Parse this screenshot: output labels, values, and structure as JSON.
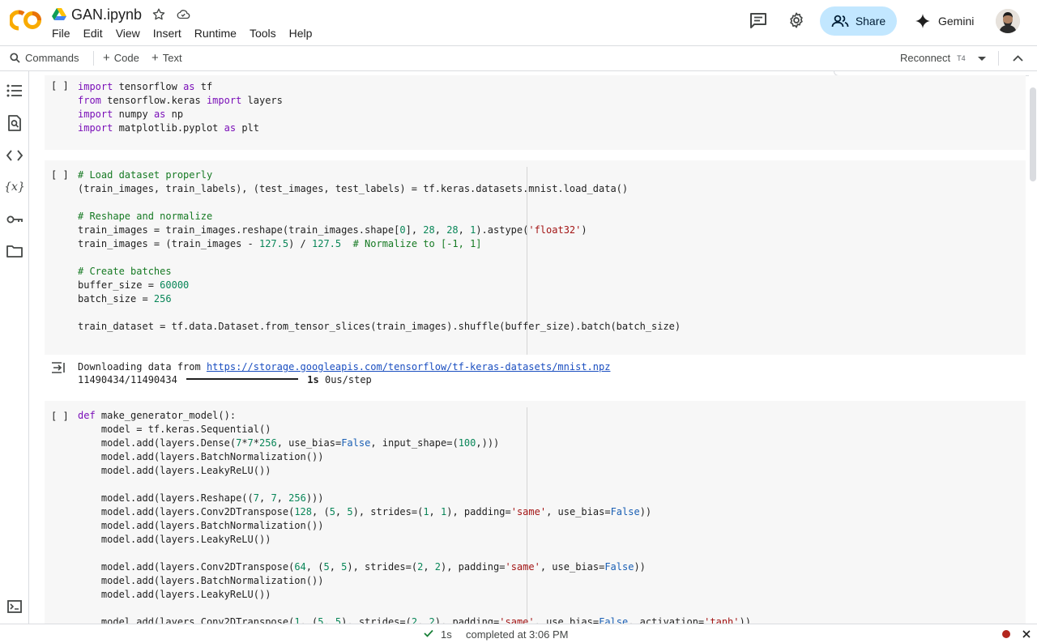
{
  "header": {
    "title": "GAN.ipynb",
    "menu": [
      "File",
      "Edit",
      "View",
      "Insert",
      "Runtime",
      "Tools",
      "Help"
    ],
    "share_label": "Share",
    "gemini_label": "Gemini"
  },
  "toolbar": {
    "commands_label": "Commands",
    "code_label": "Code",
    "text_label": "Text",
    "reconnect_label": "Reconnect",
    "runtime_type": "T4"
  },
  "colors": {
    "share_bg": "#c2e7ff",
    "keyword": "#7a0fb8",
    "comment": "#167a23",
    "number": "#098658",
    "string": "#a31515",
    "boolean": "#1a5fb4",
    "link": "#1a4ec0",
    "record": "#b3261e"
  },
  "rail_icons": [
    "table-of-contents-icon",
    "find-replace-icon",
    "code-snippets-icon",
    "variables-icon",
    "secrets-key-icon",
    "files-folder-icon",
    "terminal-icon"
  ],
  "cells": [
    {
      "run_label": "[ ]",
      "lines": [
        "import tensorflow as tf",
        "from tensorflow.keras import layers",
        "import numpy as np",
        "import matplotlib.pyplot as plt"
      ]
    },
    {
      "run_label": "[ ]",
      "lines": [
        "# Load dataset properly",
        "(train_images, train_labels), (test_images, test_labels) = tf.keras.datasets.mnist.load_data()",
        "",
        "# Reshape and normalize",
        "train_images = train_images.reshape(train_images.shape[0], 28, 28, 1).astype('float32')",
        "train_images = (train_images - 127.5) / 127.5  # Normalize to [-1, 1]",
        "",
        "# Create batches",
        "buffer_size = 60000",
        "batch_size = 256",
        "",
        "train_dataset = tf.data.Dataset.from_tensor_slices(train_images).shuffle(buffer_size).batch(batch_size)"
      ],
      "output": {
        "download_prefix": "Downloading data from ",
        "download_url": "https://storage.googleapis.com/tensorflow/tf-keras-datasets/mnist.npz",
        "progress_count": "11490434/11490434",
        "progress_fraction": 1.0,
        "progress_time": "1s",
        "progress_rate": "0us/step"
      }
    },
    {
      "run_label": "[ ]",
      "lines": [
        "def make_generator_model():",
        "    model = tf.keras.Sequential()",
        "    model.add(layers.Dense(7*7*256, use_bias=False, input_shape=(100,)))",
        "    model.add(layers.BatchNormalization())",
        "    model.add(layers.LeakyReLU())",
        "",
        "    model.add(layers.Reshape((7, 7, 256)))",
        "    model.add(layers.Conv2DTranspose(128, (5, 5), strides=(1, 1), padding='same', use_bias=False))",
        "    model.add(layers.BatchNormalization())",
        "    model.add(layers.LeakyReLU())",
        "",
        "    model.add(layers.Conv2DTranspose(64, (5, 5), strides=(2, 2), padding='same', use_bias=False))",
        "    model.add(layers.BatchNormalization())",
        "    model.add(layers.LeakyReLU())",
        "",
        "    model.add(layers.Conv2DTranspose(1, (5, 5), strides=(2, 2), padding='same', use_bias=False, activation='tanh'))"
      ]
    }
  ],
  "status": {
    "duration": "1s",
    "message": "completed at 3:06 PM"
  }
}
